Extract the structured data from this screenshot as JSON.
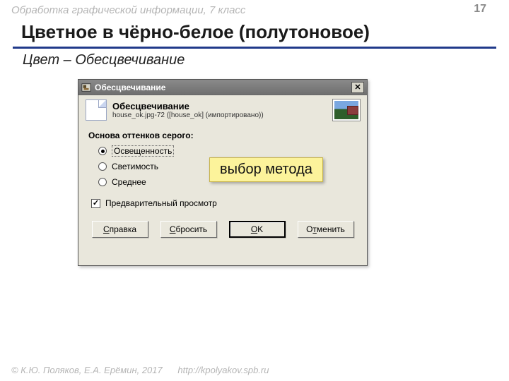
{
  "header": {
    "course": "Обработка графической информации, 7 класс",
    "page": "17"
  },
  "title": "Цветное в чёрно-белое (полутоновое)",
  "subtitle": "Цвет – Обесцвечивание",
  "dlg": {
    "titlebar": "Обесцвечивание",
    "head_title": "Обесцвечивание",
    "head_sub": "house_ok.jpg-72 ([house_ok] (импортировано))",
    "group_label": "Основа оттенков серого:",
    "radios": [
      {
        "label": "Освещенность",
        "checked": true
      },
      {
        "label": "Светимость",
        "checked": false
      },
      {
        "label": "Среднее",
        "checked": false
      }
    ],
    "preview_label": "Предварительный просмотр",
    "buttons": {
      "help": "Справка",
      "reset": "Сбросить",
      "ok": "OK",
      "cancel": "Отменить"
    }
  },
  "callout": "выбор метода",
  "footer": {
    "copyright": "© К.Ю. Поляков, Е.А. Ерёмин, 2017",
    "link": "http://kpolyakov.spb.ru"
  }
}
